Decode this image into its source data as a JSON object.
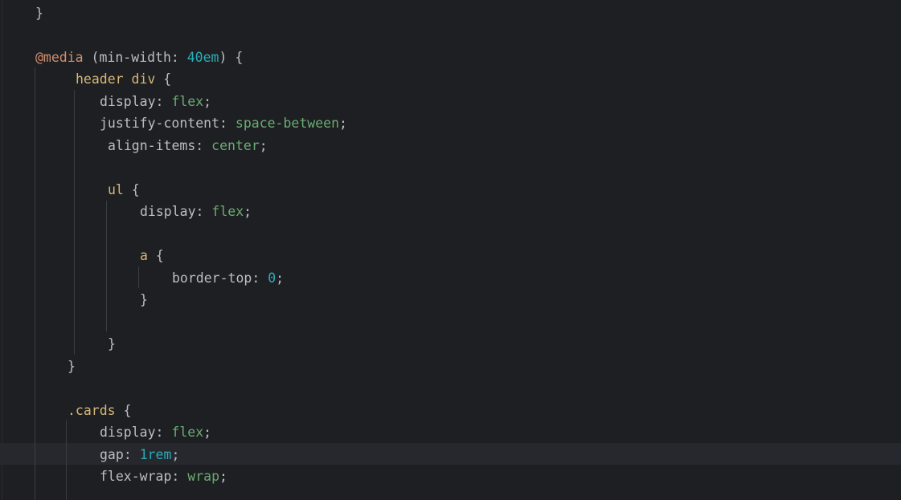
{
  "editor": {
    "lines": [
      [
        {
          "text": "}",
          "kind": "punc"
        }
      ],
      [
        {
          "text": "@media",
          "kind": "at"
        },
        {
          "text": " (min-width: ",
          "kind": "punc"
        },
        {
          "text": "40em",
          "kind": "num"
        },
        {
          "text": ") {",
          "kind": "punc"
        }
      ],
      [
        {
          "text": "header div",
          "kind": "sel"
        },
        {
          "text": " {",
          "kind": "punc"
        }
      ],
      [
        {
          "text": "display",
          "kind": "prop"
        },
        {
          "text": ": ",
          "kind": "punc"
        },
        {
          "text": "flex",
          "kind": "val"
        },
        {
          "text": ";",
          "kind": "punc"
        }
      ],
      [
        {
          "text": "justify-content",
          "kind": "prop"
        },
        {
          "text": ": ",
          "kind": "punc"
        },
        {
          "text": "space-between",
          "kind": "val"
        },
        {
          "text": ";",
          "kind": "punc"
        }
      ],
      [
        {
          "text": "align-items",
          "kind": "prop"
        },
        {
          "text": ": ",
          "kind": "punc"
        },
        {
          "text": "center",
          "kind": "val"
        },
        {
          "text": ";",
          "kind": "punc"
        }
      ],
      [
        {
          "text": "ul",
          "kind": "sel"
        },
        {
          "text": " {",
          "kind": "punc"
        }
      ],
      [
        {
          "text": "display",
          "kind": "prop"
        },
        {
          "text": ": ",
          "kind": "punc"
        },
        {
          "text": "flex",
          "kind": "val"
        },
        {
          "text": ";",
          "kind": "punc"
        }
      ],
      [
        {
          "text": "a",
          "kind": "sel"
        },
        {
          "text": " {",
          "kind": "punc"
        }
      ],
      [
        {
          "text": "border-top",
          "kind": "prop"
        },
        {
          "text": ": ",
          "kind": "punc"
        },
        {
          "text": "0",
          "kind": "num"
        },
        {
          "text": ";",
          "kind": "punc"
        }
      ],
      [
        {
          "text": "}",
          "kind": "punc"
        }
      ],
      [
        {
          "text": "}",
          "kind": "punc"
        }
      ],
      [
        {
          "text": "}",
          "kind": "punc"
        }
      ],
      [
        {
          "text": ".cards",
          "kind": "sel"
        },
        {
          "text": " {",
          "kind": "punc"
        }
      ],
      [
        {
          "text": "display",
          "kind": "prop"
        },
        {
          "text": ": ",
          "kind": "punc"
        },
        {
          "text": "flex",
          "kind": "val"
        },
        {
          "text": ";",
          "kind": "punc"
        }
      ],
      [
        {
          "text": "gap",
          "kind": "prop"
        },
        {
          "text": ": ",
          "kind": "punc"
        },
        {
          "text": "1rem",
          "kind": "num"
        },
        {
          "text": ";",
          "kind": "punc"
        }
      ],
      [
        {
          "text": "flex-wrap",
          "kind": "prop"
        },
        {
          "text": ": ",
          "kind": "punc"
        },
        {
          "text": "wrap",
          "kind": "val"
        },
        {
          "text": ";",
          "kind": "punc"
        }
      ]
    ]
  }
}
